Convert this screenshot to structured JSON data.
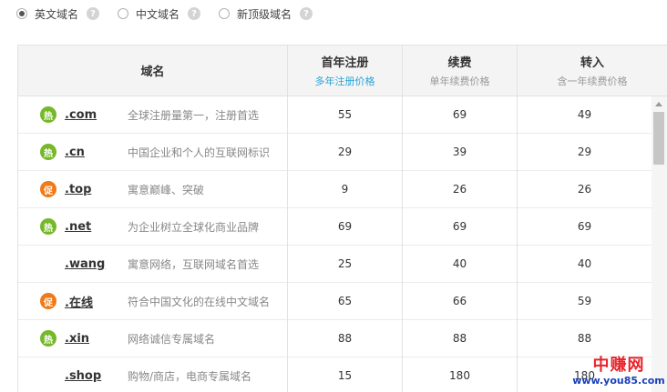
{
  "filters": [
    {
      "label": "英文域名",
      "checked": true
    },
    {
      "label": "中文域名",
      "checked": false
    },
    {
      "label": "新顶级域名",
      "checked": false
    }
  ],
  "help_icon_glyph": "?",
  "table": {
    "headers": {
      "domain": "域名",
      "register": {
        "title": "首年注册",
        "sub": "多年注册价格"
      },
      "renew": {
        "title": "续费",
        "sub": "单年续费价格"
      },
      "transfer": {
        "title": "转入",
        "sub": "含一年续费价格"
      }
    },
    "rows": [
      {
        "badge": "热",
        "badge_type": "hot",
        "tld": ".com",
        "desc": "全球注册量第一，注册首选",
        "register": "55",
        "renew": "69",
        "transfer": "49"
      },
      {
        "badge": "热",
        "badge_type": "hot",
        "tld": ".cn",
        "desc": "中国企业和个人的互联网标识",
        "register": "29",
        "renew": "39",
        "transfer": "29"
      },
      {
        "badge": "促",
        "badge_type": "promo",
        "tld": ".top",
        "desc": "寓意巅峰、突破",
        "register": "9",
        "renew": "26",
        "transfer": "26"
      },
      {
        "badge": "热",
        "badge_type": "hot",
        "tld": ".net",
        "desc": "为企业树立全球化商业品牌",
        "register": "69",
        "renew": "69",
        "transfer": "69"
      },
      {
        "badge": "",
        "badge_type": "none",
        "tld": ".wang",
        "desc": "寓意网络，互联网域名首选",
        "register": "25",
        "renew": "40",
        "transfer": "40"
      },
      {
        "badge": "促",
        "badge_type": "promo",
        "tld": ".在线",
        "desc": "符合中国文化的在线中文域名",
        "register": "65",
        "renew": "66",
        "transfer": "59"
      },
      {
        "badge": "热",
        "badge_type": "hot",
        "tld": ".xin",
        "desc": "网络诚信专属域名",
        "register": "88",
        "renew": "88",
        "transfer": "88"
      },
      {
        "badge": "",
        "badge_type": "none",
        "tld": ".shop",
        "desc": "购物/商店，电商专属域名",
        "register": "15",
        "renew": "180",
        "transfer": "180"
      }
    ]
  },
  "colors": {
    "hot": "#76b82a",
    "promo": "#ee7a1a",
    "accent": "#2aa3d6"
  },
  "watermark": {
    "cn": "中赚网",
    "url": "www.you85.com"
  }
}
